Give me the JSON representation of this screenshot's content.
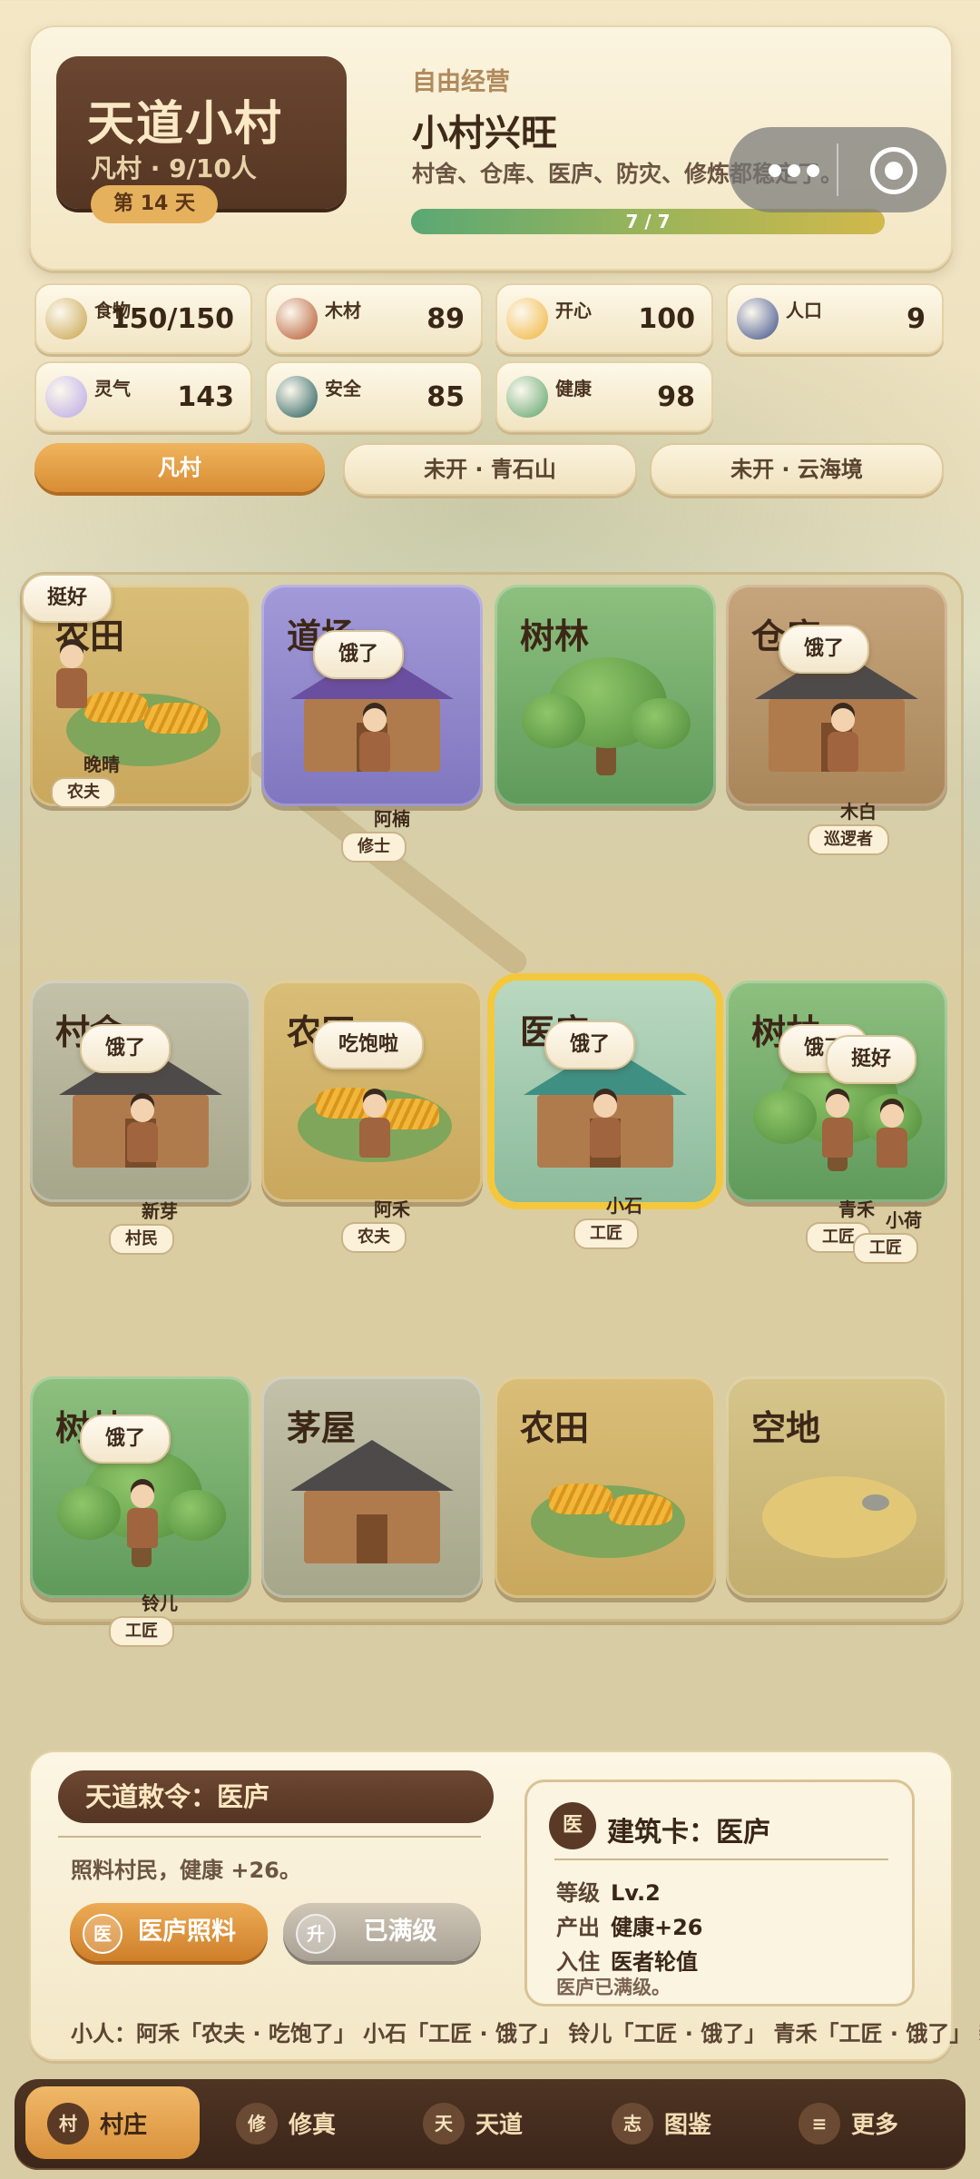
{
  "village": {
    "name": "天道小村",
    "sub": "凡村 · 9/10人",
    "day": "第 14 天"
  },
  "status": {
    "mode": "自由经营",
    "title": "小村兴旺",
    "desc": "村舍、仓库、医庐、防灾、修炼都稳定了。",
    "progress_text": "7 / 7",
    "progress": 1.0
  },
  "resources": [
    {
      "label": "食物",
      "value": "150/150",
      "icon": "grain-icon",
      "color": "#c8a24a"
    },
    {
      "label": "木材",
      "value": "89",
      "icon": "wood-icon",
      "color": "#b5552e"
    },
    {
      "label": "开心",
      "value": "100",
      "icon": "smile-icon",
      "color": "#f2b43a"
    },
    {
      "label": "人口",
      "value": "9",
      "icon": "people-icon",
      "color": "#3b4d8a"
    },
    {
      "label": "灵气",
      "value": "143",
      "icon": "spirit-icon",
      "color": "#b9a7e8"
    },
    {
      "label": "安全",
      "value": "85",
      "icon": "shield-orb-icon",
      "color": "#1f5a5a"
    },
    {
      "label": "健康",
      "value": "98",
      "icon": "herb-icon",
      "color": "#5aa36a"
    }
  ],
  "regions": [
    {
      "label": "凡村",
      "active": true
    },
    {
      "label": "未开 · 青石山",
      "active": false
    },
    {
      "label": "未开 · 云海境",
      "active": false
    }
  ],
  "tiles": [
    {
      "name": "农田",
      "kind": "farm"
    },
    {
      "name": "道场",
      "kind": "temple"
    },
    {
      "name": "树林",
      "kind": "forest"
    },
    {
      "name": "仓库",
      "kind": "store"
    },
    {
      "name": "村舍",
      "kind": "house"
    },
    {
      "name": "农田",
      "kind": "farm"
    },
    {
      "name": "医庐",
      "kind": "med"
    },
    {
      "name": "树林",
      "kind": "forest"
    },
    {
      "name": "树林",
      "kind": "forest"
    },
    {
      "name": "茅屋",
      "kind": "house"
    },
    {
      "name": "农田",
      "kind": "farm"
    },
    {
      "name": "空地",
      "kind": "empty"
    }
  ],
  "villagers": [
    {
      "name": "晚晴",
      "role": "农夫",
      "bubble": "挺好"
    },
    {
      "name": "阿楠",
      "role": "修士",
      "bubble": "饿了"
    },
    {
      "name": "木白",
      "role": "巡逻者",
      "bubble": "饿了"
    },
    {
      "name": "新芽",
      "role": "村民",
      "bubble": "饿了"
    },
    {
      "name": "阿禾",
      "role": "农夫",
      "bubble": "吃饱啦"
    },
    {
      "name": "小石",
      "role": "工匠",
      "bubble": "饿了"
    },
    {
      "name": "青禾",
      "role": "工匠",
      "bubble": "饿了"
    },
    {
      "name": "小荷",
      "role": "工匠",
      "bubble": "挺好"
    },
    {
      "name": "铃儿",
      "role": "工匠",
      "bubble": "饿了"
    }
  ],
  "decree": {
    "title": "天道敕令：医庐",
    "desc": "照料村民，健康 +26。",
    "action1": {
      "icon": "医",
      "label": "医庐照料"
    },
    "action2": {
      "icon": "升",
      "label": "已满级"
    }
  },
  "card": {
    "icon": "医",
    "title": "建筑卡：医庐",
    "rows": [
      {
        "k": "等级",
        "v": "Lv.2"
      },
      {
        "k": "产出",
        "v": "健康+26"
      },
      {
        "k": "入住",
        "v": "医者轮值"
      }
    ],
    "note": "医庐已满级。"
  },
  "ticker": "小人：阿禾「农夫 · 吃饱了」 小石「工匠 · 饿了」 铃儿「工匠 · 饿了」 青禾「工匠 · 饿了」 新芽",
  "nav": [
    {
      "icon": "村",
      "label": "村庄",
      "active": true
    },
    {
      "icon": "修",
      "label": "修真",
      "active": false
    },
    {
      "icon": "天",
      "label": "天道",
      "active": false
    },
    {
      "icon": "志",
      "label": "图鉴",
      "active": false
    },
    {
      "icon": "≡",
      "label": "更多",
      "active": false
    }
  ]
}
